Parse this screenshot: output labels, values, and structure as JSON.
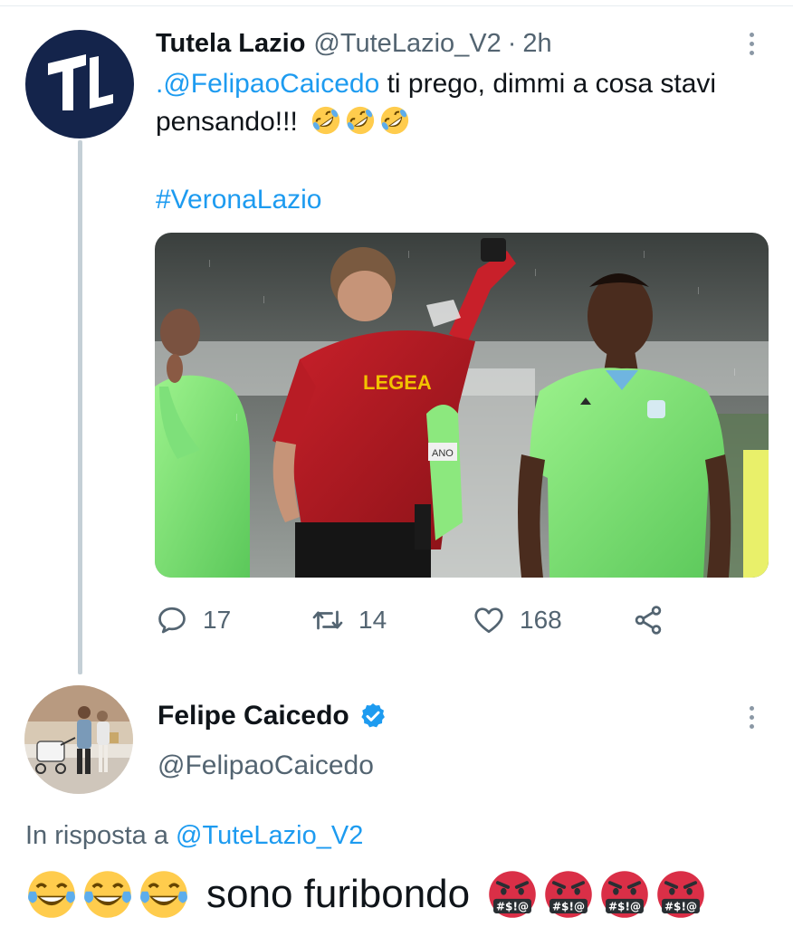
{
  "tweet": {
    "author_name": "Tutela Lazio",
    "author_handle": "@TuteLazio_V2",
    "separator": "·",
    "time": "2h",
    "mention": ".@FelipaoCaicedo",
    "text_after_mention": " ti prego, dimmi a cosa stavi pensando!!!",
    "emojis": [
      "rolling-on-floor-laughing",
      "rolling-on-floor-laughing",
      "rolling-on-floor-laughing"
    ],
    "hashtag": "#VeronaLazio",
    "media": {
      "kit_text_sponsor": "LEGEA",
      "kit_text_sleeve": "ANO"
    },
    "stats": {
      "replies": "17",
      "retweets": "14",
      "likes": "168"
    }
  },
  "reply": {
    "author_name": "Felipe Caicedo",
    "author_handle": "@FelipaoCaicedo",
    "verified": true,
    "reply_to_prefix": "In risposta a ",
    "reply_to_handle": "@TuteLazio_V2",
    "text": "sono furibondo",
    "leading_emojis": [
      "face-with-tears-of-joy",
      "face-with-tears-of-joy",
      "face-with-tears-of-joy"
    ],
    "trailing_emojis": [
      "face-with-symbols-on-mouth",
      "face-with-symbols-on-mouth",
      "face-with-symbols-on-mouth",
      "face-with-symbols-on-mouth"
    ],
    "cursing_symbols": "#$!@"
  },
  "colors": {
    "link": "#1d9bf0",
    "secondary_text": "#536471",
    "thread_line": "#c4cfd6",
    "verified": "#1d9bf0",
    "brand_avatar": "#14244b"
  }
}
